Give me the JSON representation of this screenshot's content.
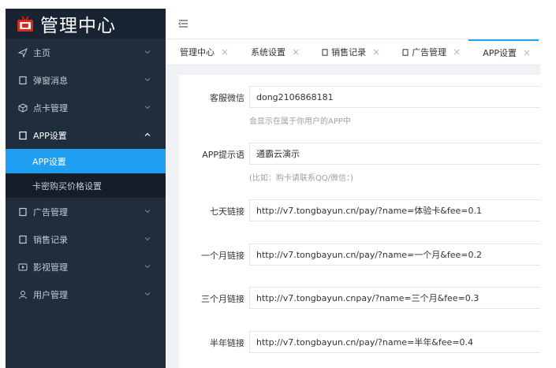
{
  "app": {
    "title": "管理中心",
    "logo_icon": "tv-icon",
    "brand_color": "#e1251b"
  },
  "sidebar": {
    "items": [
      {
        "label": "主页",
        "icon": "send-icon"
      },
      {
        "label": "弹窗消息",
        "icon": "square-icon"
      },
      {
        "label": "点卡管理",
        "icon": "cube-icon"
      },
      {
        "label": "APP设置",
        "icon": "square-icon",
        "open": true,
        "children": [
          {
            "label": "APP设置",
            "active": true
          },
          {
            "label": "卡密购买价格设置"
          }
        ]
      },
      {
        "label": "广告管理",
        "icon": "square-icon"
      },
      {
        "label": "销售记录",
        "icon": "square-icon"
      },
      {
        "label": "影视管理",
        "icon": "play-icon"
      },
      {
        "label": "用户管理",
        "icon": "user-icon"
      }
    ]
  },
  "tabs": [
    {
      "label": "管理中心",
      "icon": false
    },
    {
      "label": "系统设置",
      "icon": false
    },
    {
      "label": "销售记录",
      "icon": true
    },
    {
      "label": "广告管理",
      "icon": true
    },
    {
      "label": "APP设置",
      "icon": false,
      "active": true
    }
  ],
  "form": {
    "fields": [
      {
        "label": "客服微信",
        "value": "dong2106868181",
        "hint": "会显示在属于你用户的APP中"
      },
      {
        "label": "APP提示语",
        "value": "通霸云演示",
        "hint": "(比如：购卡请联系QQ/微信：)"
      },
      {
        "label": "七天链接",
        "value": "http://v7.tongbayun.cn/pay/?name=体验卡&fee=0.1"
      },
      {
        "label": "一个月链接",
        "value": "http://v7.tongbayun.cn/pay/?name=一个月&fee=0.2"
      },
      {
        "label": "三个月链接",
        "value": "http://v7.tongbayun.cnpay/?name=三个月&fee=0.3"
      },
      {
        "label": "半年链接",
        "value": "http://v7.tongbayun.cn/pay/?name=半年&fee=0.4"
      }
    ]
  },
  "colors": {
    "sidebar": "#1f2d3d",
    "accent": "#1e9ff2"
  }
}
